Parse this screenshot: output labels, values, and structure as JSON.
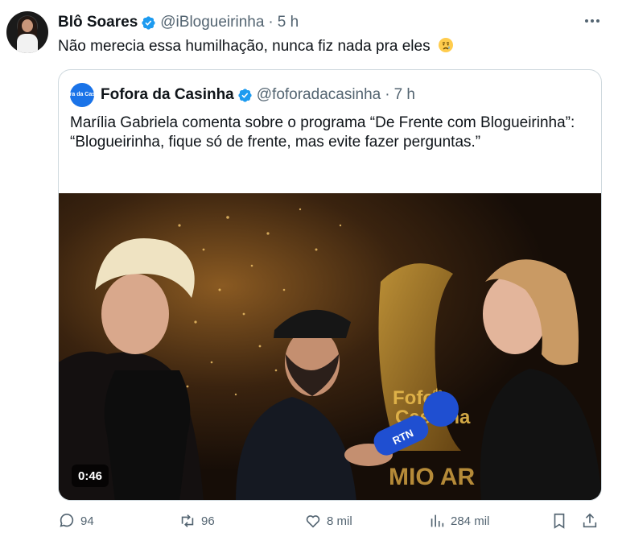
{
  "post": {
    "author_name": "Blô Soares",
    "author_handle": "@iBlogueirinha",
    "separator": "·",
    "time": "5 h",
    "text": "Não merecia essa humilhação, nunca fiz nada pra eles",
    "emoji": "crying-face",
    "more_icon": "more-horizontal-icon"
  },
  "quote": {
    "author_name": "Fofora da Casinha",
    "avatar_text": "Fofora da Casinha",
    "author_handle": "@foforadacasinha",
    "separator": "·",
    "time": "7 h",
    "text": "Marília Gabriela comenta sobre o programa “De Frente com Blogueirinha”: “Blogueirinha, fique só de frente, mas evite fazer perguntas.”",
    "video": {
      "duration": "0:46",
      "logo_text_1": "Fofora",
      "logo_text_2": "Casinha",
      "logo_text_small": "da",
      "mic_text": "RTN",
      "banner_text": "MIO AR"
    }
  },
  "actions": {
    "replies": "94",
    "reposts": "96",
    "likes": "8 mil",
    "views": "284 mil"
  },
  "colors": {
    "verified": "#1d9bf0",
    "secondary_text": "#536471",
    "border": "#cfd9de",
    "mic_blue": "#1f4fd1"
  }
}
